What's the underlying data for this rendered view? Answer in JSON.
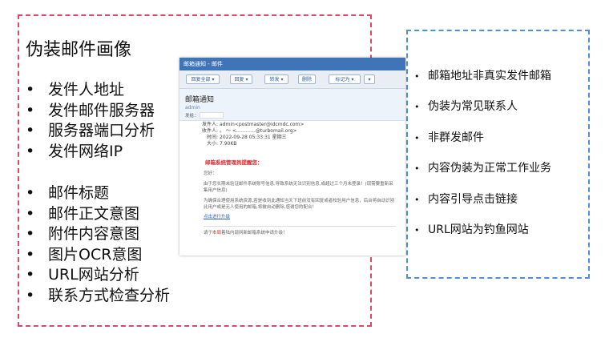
{
  "left": {
    "title": "伪装邮件画像",
    "bullet": "•",
    "group1": [
      "发件人地址",
      "发件邮件服务器",
      "服务器端口分析",
      "发件网络IP"
    ],
    "group2": [
      "邮件标题",
      "邮件正文意图",
      "附件内容意图",
      "图片OCR意图",
      "URL网站分析",
      "联系方式检查分析"
    ]
  },
  "right": {
    "bullet": "•",
    "items": [
      "邮箱地址非真实发件邮箱",
      "伪装为常见联系人",
      "非群发邮件",
      "内容伪装为正常工作业务",
      "内容引导点击链接",
      "URL网站为钓鱼网站"
    ]
  },
  "email": {
    "window_title": "邮箱通知 - 邮件",
    "toolbar": {
      "reply_all": "回复全部 ▾",
      "reply": "回复 ▾",
      "forward": "转发 ▾",
      "delete": "删除",
      "mark_as": "标记为 ▾",
      "more": "▾"
    },
    "subject": "邮箱通知",
    "sender_name": "admin",
    "sendto_label": "发给：",
    "meta": {
      "from_label": "发件人:",
      "from_value": "admin<postmaster@idcmdc.com>",
      "to_label": "收件人:",
      "to_value": "。 ～ <…………@turbomail.org>",
      "time_label": "时间:",
      "time_value": "2022-09-28 05:33:31 星期三",
      "size_label": "大小:",
      "size_value": "7.90KB"
    },
    "body": {
      "warning": "邮箱系统管理员提醒您：",
      "greeting": "您好：",
      "para1": "由于您长期未验证邮件系统账号信息,导致系统无法识别信息,或超过三个月未登录！(现需要重新采集用户信息)",
      "para2": "为确保合理使用系统资源,若是收到此通知当天下班前没有回复或者校验用户信息，后台将自动识别此用户或是无人使用的邮箱,将被自动删除,感谢您的配合！",
      "link": "点击进行升级",
      "footer_a": "请于",
      "footer_red": "本周",
      "footer_b": "着陆内部网新邮箱系统申请升级！"
    }
  }
}
